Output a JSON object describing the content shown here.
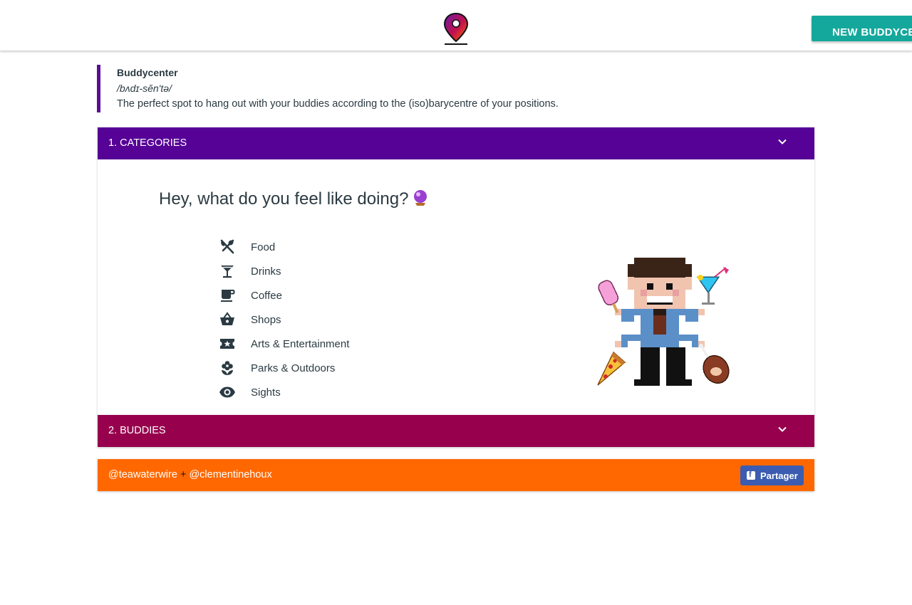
{
  "header": {
    "new_button_label": "NEW BUDDYCENTER"
  },
  "definition": {
    "term": "Buddycenter",
    "phonetic": "/bʌdɪ-sĕn'tə/",
    "text": "The perfect spot to hang out with your buddies according to the (iso)barycentre of your positions."
  },
  "categories_panel": {
    "title": "1. CATEGORIES",
    "question": "Hey, what do you feel like doing?",
    "items": [
      {
        "label": "Food",
        "icon": "fork-spoon-icon"
      },
      {
        "label": "Drinks",
        "icon": "cocktail-icon"
      },
      {
        "label": "Coffee",
        "icon": "coffee-cup-icon"
      },
      {
        "label": "Shops",
        "icon": "basket-icon"
      },
      {
        "label": "Arts & Entertainment",
        "icon": "ticket-star-icon"
      },
      {
        "label": "Parks & Outdoors",
        "icon": "flower-icon"
      },
      {
        "label": "Sights",
        "icon": "eye-icon"
      }
    ]
  },
  "buddies_panel": {
    "title": "2. BUDDIES"
  },
  "footer": {
    "author1": "@teawaterwire",
    "plus": "+",
    "author2": "@clementinehoux",
    "share_label": "Partager"
  },
  "colors": {
    "categories_header": "#560296",
    "buddies_header": "#97004d",
    "footer": "#ff6800",
    "accent": "#14a89c",
    "share_button": "#3b5cb0"
  }
}
